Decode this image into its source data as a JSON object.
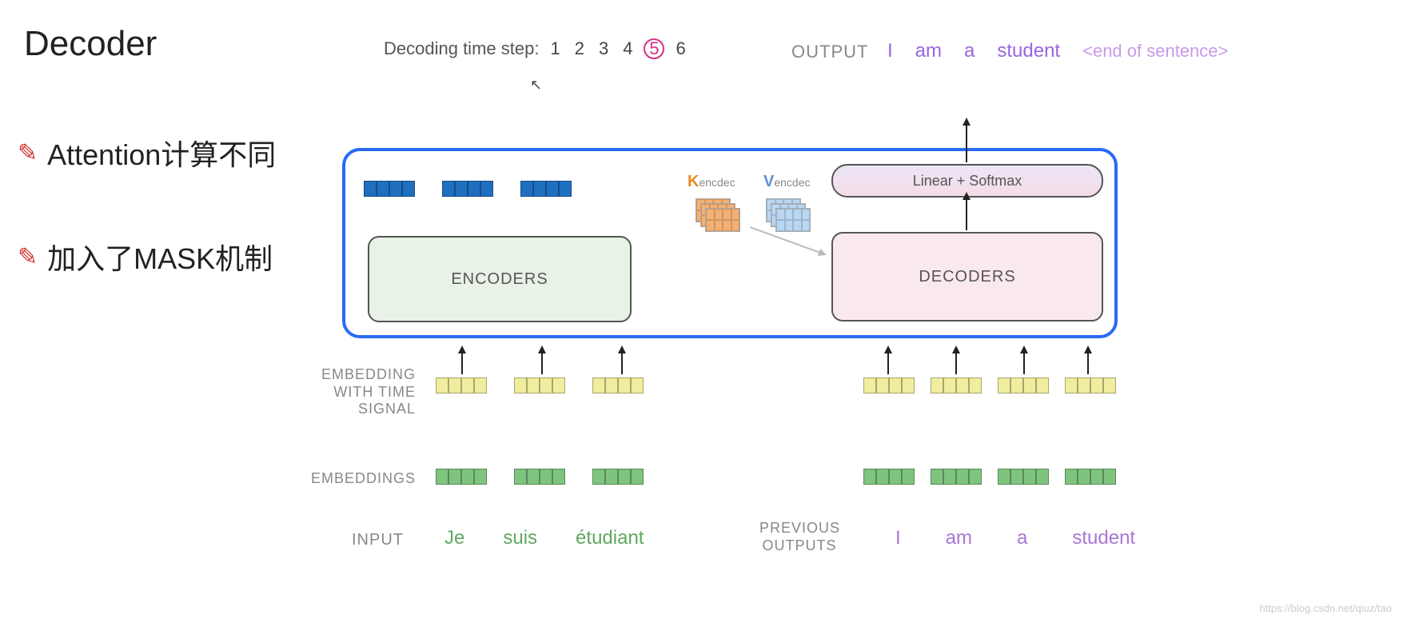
{
  "title": "Decoder",
  "bullets": [
    "Attention计算不同",
    "加入了MASK机制"
  ],
  "step_label": "Decoding time step:",
  "steps": [
    "1",
    "2",
    "3",
    "4",
    "5",
    "6"
  ],
  "current_step_index": 4,
  "output_label": "OUTPUT",
  "output_words": [
    "I",
    "am",
    "a",
    "student",
    "<end of sentence>"
  ],
  "encoders_label": "ENCODERS",
  "decoders_label": "DECODERS",
  "linear_label": "Linear + Softmax",
  "k_label": {
    "pref": "K",
    "sub": "encdec"
  },
  "v_label": {
    "pref": "V",
    "sub": "encdec"
  },
  "row_labels": {
    "emb_time": "EMBEDDING WITH TIME SIGNAL",
    "emb": "EMBEDDINGS",
    "input": "INPUT",
    "prev": "PREVIOUS OUTPUTS"
  },
  "input_words": [
    "Je",
    "suis",
    "étudiant"
  ],
  "prev_words": [
    "I",
    "am",
    "a",
    "student"
  ],
  "watermark": "https://blog.csdn.net/qiuz/tao"
}
